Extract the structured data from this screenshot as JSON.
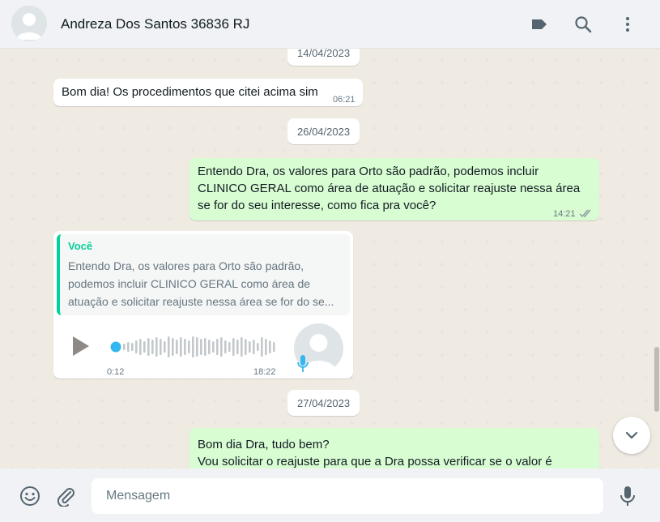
{
  "header": {
    "contact_name": "Andreza Dos Santos 36836 RJ",
    "icons": [
      "label-icon",
      "search-icon",
      "menu-icon"
    ]
  },
  "chat": {
    "dates": [
      "14/04/2023",
      "26/04/2023",
      "27/04/2023"
    ],
    "messages": [
      {
        "direction": "in",
        "text": "Bom dia! Os procedimentos que citei acima sim",
        "time": "06:21"
      },
      {
        "direction": "out",
        "lines": [
          "Entendo Dra, os valores para Orto são padrão, podemos incluir",
          "CLINICO GERAL como área de atuação e solicitar reajuste nessa área",
          "se for do seu interesse, como fica pra você?"
        ],
        "time": "14:21",
        "status": "read"
      },
      {
        "direction": "in",
        "type": "audio",
        "quote": {
          "author": "Você",
          "lines": [
            "Entendo Dra, os valores para Orto são padrão,",
            "podemos incluir CLINICO GERAL como área de",
            "atuação e solicitar reajuste nessa área se for do se..."
          ]
        },
        "duration": "0:12",
        "time": "18:22"
      },
      {
        "direction": "out",
        "lines": [
          "Bom dia Dra, tudo bem?",
          "Vou solicitar o reajuste para que a Dra possa verificar se o valor é"
        ]
      }
    ]
  },
  "footer": {
    "placeholder": "Mensagem",
    "icons": [
      "emoji-icon",
      "attach-icon",
      "mic-icon"
    ]
  },
  "colors": {
    "incoming_bubble": "#ffffff",
    "outgoing_bubble": "#d9fdd3",
    "accent": "#06cf9c",
    "background": "#efeae2"
  }
}
